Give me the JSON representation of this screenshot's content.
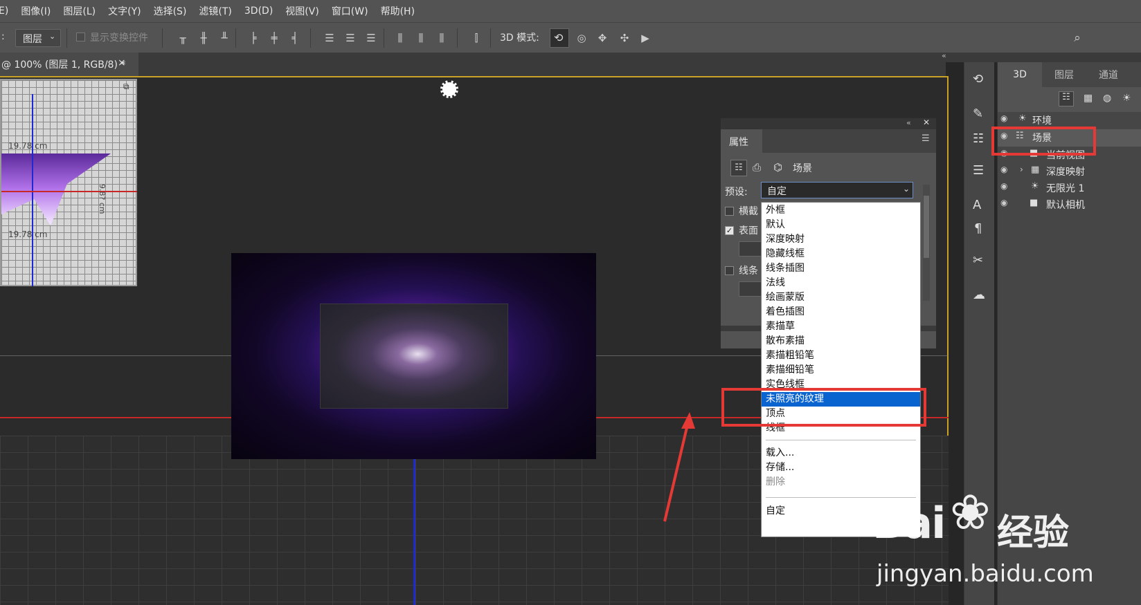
{
  "menubar": {
    "items": [
      "E)",
      "图像(I)",
      "图层(L)",
      "文字(Y)",
      "选择(S)",
      "滤镜(T)",
      "3D(D)",
      "视图(V)",
      "窗口(W)",
      "帮助(H)"
    ]
  },
  "options": {
    "prefix": ":",
    "layer_select": "图层",
    "show_transform": "显示变换控件",
    "mode_label": "3D 模式:"
  },
  "doc_tab": {
    "title": "@ 100% (图层 1, RGB/8) *",
    "close": "×"
  },
  "ruler": {
    "label_top": "19.78 cm",
    "label_bottom": "19.78 cm",
    "label_side": "9.8? cm"
  },
  "panel3d": {
    "tabs": [
      "3D",
      "图层",
      "通道"
    ],
    "layers": [
      {
        "name": "环境",
        "icon": "sun-icon"
      },
      {
        "name": "场景",
        "icon": "scene-icon"
      },
      {
        "name": "当前视图",
        "icon": "camera-icon"
      },
      {
        "name": "深度映射",
        "icon": "mesh-icon"
      },
      {
        "name": "无限光 1",
        "icon": "sun-icon"
      },
      {
        "name": "默认相机",
        "icon": "camera-icon"
      }
    ]
  },
  "properties": {
    "title": "属性",
    "subtitle": "场景",
    "preset_label": "预设:",
    "preset_value": "自定",
    "checks": [
      {
        "label": "横截",
        "checked": false
      },
      {
        "label": "表面",
        "checked": true
      },
      {
        "label": "线条",
        "checked": false
      }
    ]
  },
  "dropdown": {
    "items": [
      "外框",
      "默认",
      "深度映射",
      "隐藏线框",
      "线条插图",
      "法线",
      "绘画蒙版",
      "着色插图",
      "素描草",
      "散布素描",
      "素描粗铅笔",
      "素描细铅笔",
      "实色线框",
      "未照亮的纹理",
      "顶点",
      "线框"
    ],
    "selected": "未照亮的纹理",
    "actions": [
      "载入...",
      "存储...",
      "删除"
    ],
    "disabled": [
      "删除"
    ],
    "footer": "自定"
  },
  "watermark": {
    "brand": "Bai",
    "brand_suffix": "经验",
    "url": "jingyan.baidu.com"
  },
  "colors": {
    "highlight": "#0a64d0",
    "annotation_red": "#e53935",
    "canvas_border": "#c9a227"
  }
}
